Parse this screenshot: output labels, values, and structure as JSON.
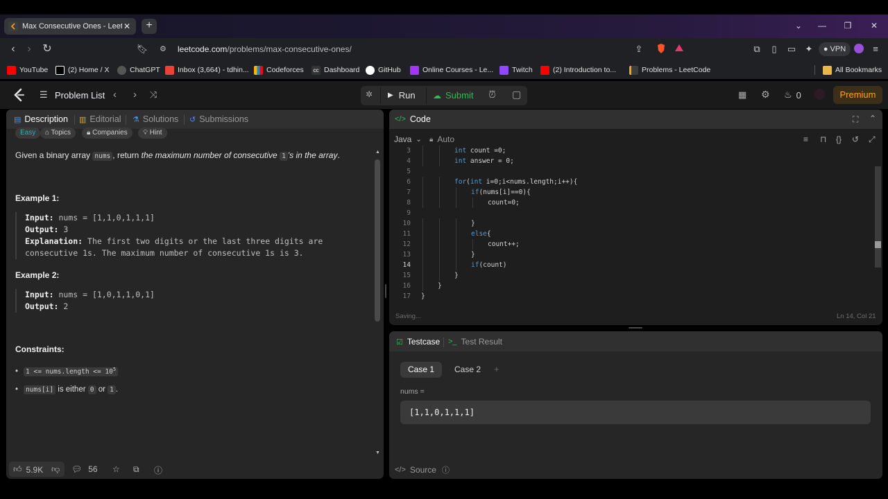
{
  "browser": {
    "tab_title": "Max Consecutive Ones - LeetC",
    "url_host": "leetcode.com",
    "url_path": "/problems/max-consecutive-ones/",
    "vpn_label": "VPN",
    "bookmarks": [
      {
        "label": "YouTube",
        "color": "#ff0000"
      },
      {
        "label": "(2) Home / X",
        "color": "#ffffff"
      },
      {
        "label": "ChatGPT",
        "color": "#cccccc"
      },
      {
        "label": "Inbox (3,664) - tdhin...",
        "color": "#ea4335"
      },
      {
        "label": "Codeforces",
        "color": "#f5b400"
      },
      {
        "label": "Dashboard",
        "color": "#eeeeee"
      },
      {
        "label": "GitHub",
        "color": "#ffffff"
      },
      {
        "label": "Online Courses - Le...",
        "color": "#a435f0"
      },
      {
        "label": "Twitch",
        "color": "#9146ff"
      },
      {
        "label": "(2) Introduction to...",
        "color": "#ff0000"
      },
      {
        "label": "Problems - LeetCode",
        "color": "#ffa116"
      }
    ],
    "all_bookmarks": "All Bookmarks"
  },
  "lc_nav": {
    "problem_list": "Problem List",
    "run": "Run",
    "submit": "Submit",
    "streak": "0",
    "premium": "Premium"
  },
  "left": {
    "tabs": [
      "Description",
      "Editorial",
      "Solutions",
      "Submissions"
    ],
    "chips": [
      "Easy",
      "Topics",
      "Companies",
      "Hint"
    ],
    "desc_pre": "Given a binary array",
    "desc_code": "nums",
    "desc_mid": ", return",
    "desc_italic_1": "the maximum number of consecutive",
    "desc_code2": "1",
    "desc_italic_2": "'s in the array",
    "desc_end": ".",
    "example1_title": "Example 1:",
    "example1_input_label": "Input:",
    "example1_input": "nums = [1,1,0,1,1,1]",
    "example1_output_label": "Output:",
    "example1_output": "3",
    "example1_expl_label": "Explanation:",
    "example1_expl_1": "The first two digits or the last three digits are",
    "example1_expl_2": "consecutive 1s. The maximum number of consecutive 1s is 3.",
    "example2_title": "Example 2:",
    "example2_input_label": "Input:",
    "example2_input": "nums = [1,0,1,1,0,1]",
    "example2_output_label": "Output:",
    "example2_output": "2",
    "constraints_title": "Constraints:",
    "constraint1_code": "1 <= nums.length <= 10",
    "constraint1_sup": "5",
    "constraint2_code": "nums[i]",
    "constraint2_mid": "is either",
    "constraint2_a": "0",
    "constraint2_or": "or",
    "constraint2_b": "1",
    "constraint2_end": ".",
    "likes": "5.9K",
    "comments": "56"
  },
  "code": {
    "title": "Code",
    "language": "Java",
    "auto": "Auto",
    "lines": [
      {
        "n": "3",
        "indent": 2,
        "text": "int count =0;"
      },
      {
        "n": "4",
        "indent": 2,
        "text": "int answer = 0;"
      },
      {
        "n": "5",
        "indent": 0,
        "text": ""
      },
      {
        "n": "6",
        "indent": 2,
        "text": "for(int i=0;i<nums.length;i++){"
      },
      {
        "n": "7",
        "indent": 3,
        "text": "if(nums[i]==0){"
      },
      {
        "n": "8",
        "indent": 4,
        "text": "count=0;"
      },
      {
        "n": "9",
        "indent": 0,
        "text": ""
      },
      {
        "n": "10",
        "indent": 3,
        "text": "}"
      },
      {
        "n": "11",
        "indent": 3,
        "text": "else{"
      },
      {
        "n": "12",
        "indent": 4,
        "text": "count++;"
      },
      {
        "n": "13",
        "indent": 3,
        "text": "}"
      },
      {
        "n": "14",
        "indent": 3,
        "text": "if(count)"
      },
      {
        "n": "15",
        "indent": 2,
        "text": "}"
      },
      {
        "n": "16",
        "indent": 1,
        "text": "}"
      },
      {
        "n": "17",
        "indent": 0,
        "text": "}"
      }
    ],
    "current_line": "14",
    "saving": "Saving...",
    "cursor_pos": "Ln 14, Col 21"
  },
  "testcase": {
    "tab_testcase": "Testcase",
    "tab_result": "Test Result",
    "cases": [
      "Case 1",
      "Case 2"
    ],
    "param_label": "nums =",
    "param_value": "[1,1,0,1,1,1]",
    "source": "Source"
  },
  "colors": {
    "accent_green": "#2cbb5d",
    "easy": "#1cbaba",
    "premium": "#ffa116"
  }
}
